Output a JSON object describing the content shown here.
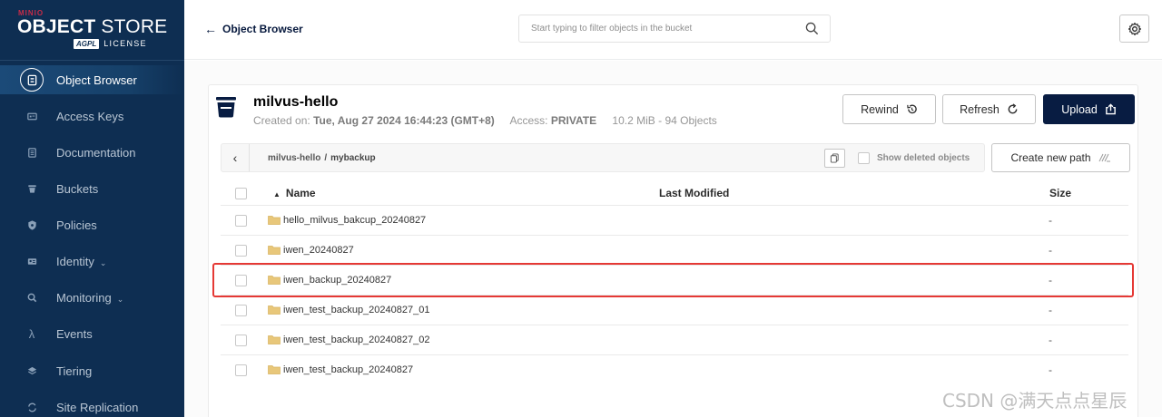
{
  "brand": {
    "minio": "MINIO",
    "title_bold": "OBJECT",
    "title_rest": " STORE",
    "agpl": "AGPL",
    "license": "LICENSE"
  },
  "sidebar": {
    "items": [
      {
        "label": "Object Browser",
        "icon": "object-browser-icon",
        "active": true
      },
      {
        "label": "Access Keys",
        "icon": "key-icon"
      },
      {
        "label": "Documentation",
        "icon": "document-icon"
      },
      {
        "label": "Buckets",
        "icon": "bucket-icon"
      },
      {
        "label": "Policies",
        "icon": "shield-icon"
      },
      {
        "label": "Identity",
        "icon": "identity-icon",
        "chevron": true
      },
      {
        "label": "Monitoring",
        "icon": "magnifier-icon",
        "chevron": true
      },
      {
        "label": "Events",
        "icon": "lambda-icon"
      },
      {
        "label": "Tiering",
        "icon": "layers-icon"
      },
      {
        "label": "Site Replication",
        "icon": "replication-icon"
      }
    ]
  },
  "topbar": {
    "title": "Object Browser",
    "search_placeholder": "Start typing to filter objects in the bucket"
  },
  "bucket": {
    "name": "milvus-hello",
    "created_label": "Created on:",
    "created_value": "Tue, Aug 27 2024 16:44:23 (GMT+8)",
    "access_label": "Access:",
    "access_value": "PRIVATE",
    "usage": "10.2 MiB - 94 Objects"
  },
  "actions": {
    "rewind": "Rewind",
    "refresh": "Refresh",
    "upload": "Upload",
    "create_path": "Create new path"
  },
  "path": {
    "root": "milvus-hello",
    "separator": "/",
    "current": "mybackup",
    "show_deleted": "Show deleted objects"
  },
  "table": {
    "columns": {
      "name": "Name",
      "modified": "Last Modified",
      "size": "Size"
    },
    "rows": [
      {
        "name": "hello_milvus_bakcup_20240827",
        "modified": "",
        "size": "-"
      },
      {
        "name": "iwen_20240827",
        "modified": "",
        "size": "-"
      },
      {
        "name": "iwen_backup_20240827",
        "modified": "",
        "size": "-",
        "highlighted": true
      },
      {
        "name": "iwen_test_backup_20240827_01",
        "modified": "",
        "size": "-"
      },
      {
        "name": "iwen_test_backup_20240827_02",
        "modified": "",
        "size": "-"
      },
      {
        "name": "iwen_test_backup_20240827",
        "modified": "",
        "size": "-"
      }
    ]
  },
  "watermark": "CSDN @满天点点星辰",
  "colors": {
    "sidebar_bg": "#0e2e52",
    "primary": "#081c42",
    "highlight": "#e53935",
    "brand_red": "#c72c48",
    "folder": "#e8c77a"
  }
}
